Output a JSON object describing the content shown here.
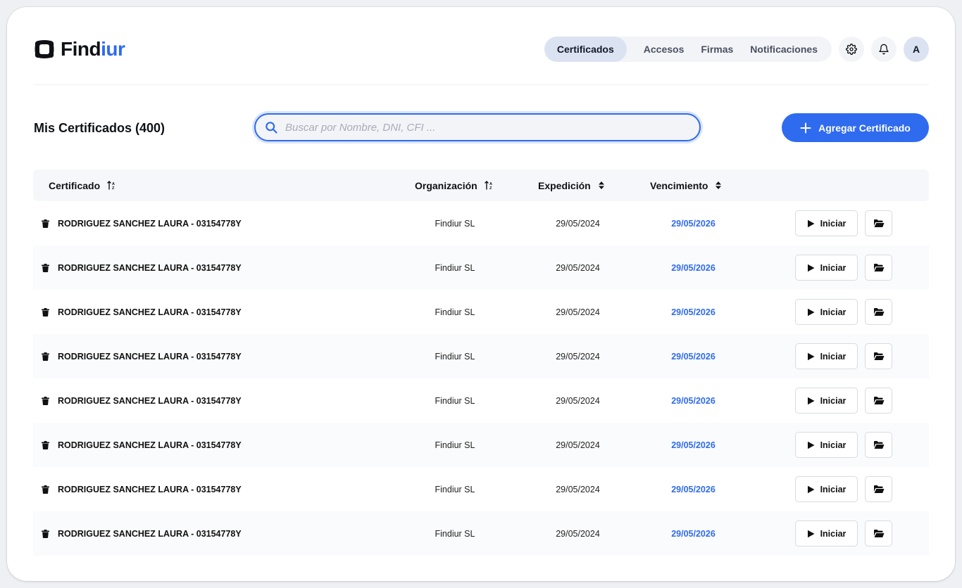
{
  "app": {
    "logo_prefix": "Find",
    "logo_accent": "iur",
    "accent_color": "#2f6bef"
  },
  "nav": {
    "items": [
      {
        "label": "Certificados",
        "active": true
      },
      {
        "label": "Accesos",
        "active": false
      },
      {
        "label": "Firmas",
        "active": false
      },
      {
        "label": "Notificaciones",
        "active": false
      }
    ],
    "settings_icon": "gear-icon",
    "notifications_icon": "bell-icon",
    "avatar_initial": "A"
  },
  "toolbar": {
    "title": "Mis Certificados (400)",
    "search_placeholder": "Buscar por Nombre, DNI, CFI ...",
    "search_icon": "search-icon",
    "add_label": "Agregar Certificado",
    "add_icon": "plus-icon"
  },
  "table": {
    "columns": [
      {
        "label": "Certificado",
        "sort_icon": "sort-alpha-icon"
      },
      {
        "label": "Organización",
        "sort_icon": "sort-alpha-icon"
      },
      {
        "label": "Expedición",
        "sort_icon": "sort-updown-icon"
      },
      {
        "label": "Vencimiento",
        "sort_icon": "sort-updown-icon"
      }
    ],
    "action_label": "Iniciar",
    "rows": [
      {
        "name": "RODRIGUEZ SANCHEZ LAURA - 03154778Y",
        "org": "Findiur SL",
        "issued": "29/05/2024",
        "expires": "29/05/2026"
      },
      {
        "name": "RODRIGUEZ SANCHEZ LAURA - 03154778Y",
        "org": "Findiur SL",
        "issued": "29/05/2024",
        "expires": "29/05/2026"
      },
      {
        "name": "RODRIGUEZ SANCHEZ LAURA - 03154778Y",
        "org": "Findiur SL",
        "issued": "29/05/2024",
        "expires": "29/05/2026"
      },
      {
        "name": "RODRIGUEZ SANCHEZ LAURA - 03154778Y",
        "org": "Findiur SL",
        "issued": "29/05/2024",
        "expires": "29/05/2026"
      },
      {
        "name": "RODRIGUEZ SANCHEZ LAURA - 03154778Y",
        "org": "Findiur SL",
        "issued": "29/05/2024",
        "expires": "29/05/2026"
      },
      {
        "name": "RODRIGUEZ SANCHEZ LAURA - 03154778Y",
        "org": "Findiur SL",
        "issued": "29/05/2024",
        "expires": "29/05/2026"
      },
      {
        "name": "RODRIGUEZ SANCHEZ LAURA - 03154778Y",
        "org": "Findiur SL",
        "issued": "29/05/2024",
        "expires": "29/05/2026"
      },
      {
        "name": "RODRIGUEZ SANCHEZ LAURA - 03154778Y",
        "org": "Findiur SL",
        "issued": "29/05/2024",
        "expires": "29/05/2026"
      }
    ]
  }
}
